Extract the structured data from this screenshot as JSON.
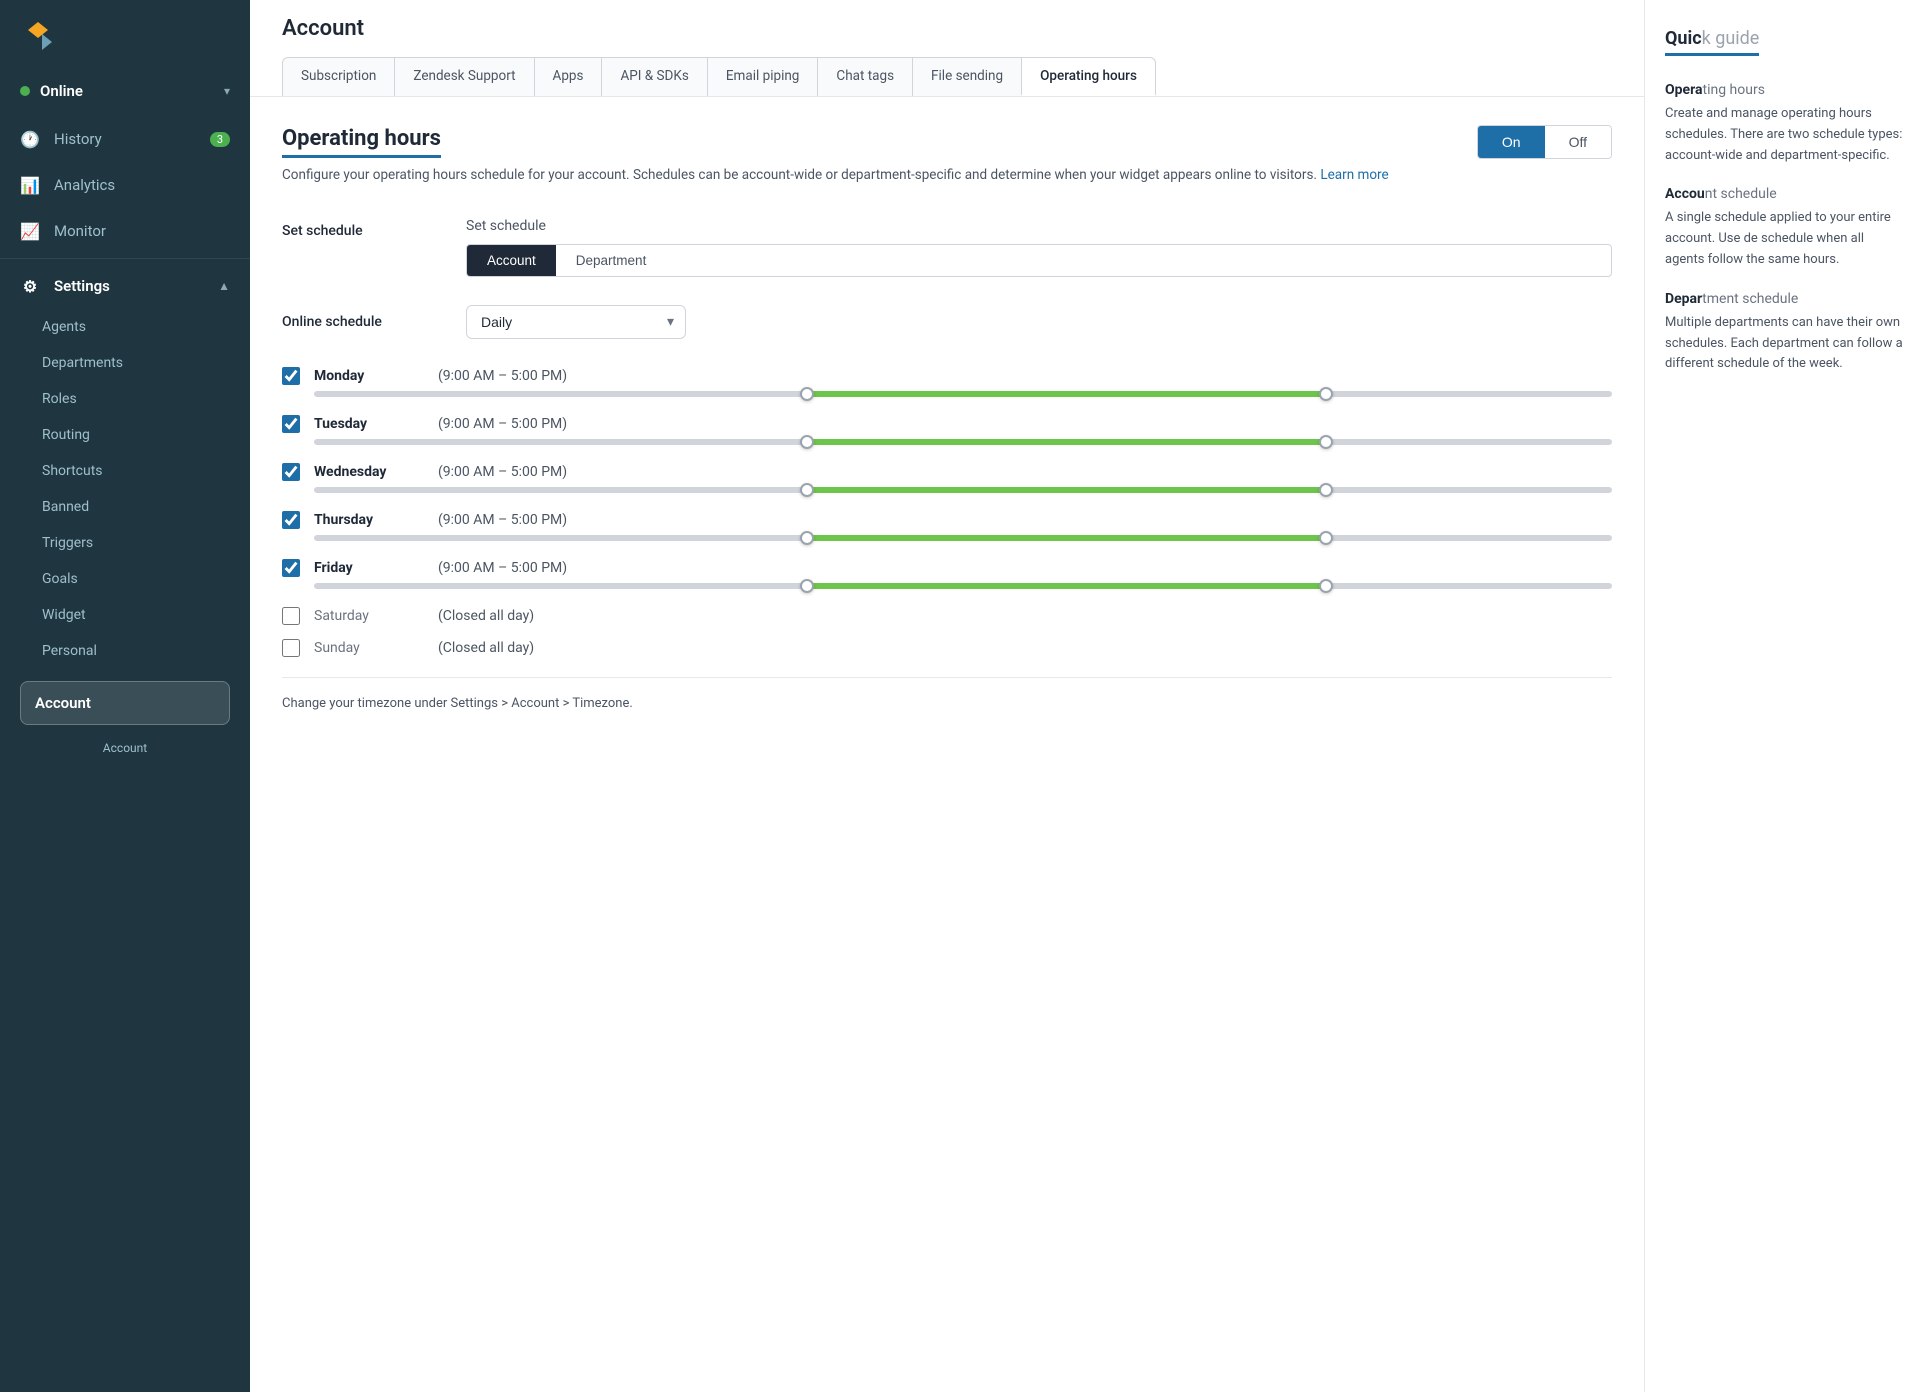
{
  "app": {
    "title": "Account"
  },
  "sidebar": {
    "logo_alt": "Zendesk Chat logo",
    "status": {
      "label": "Online",
      "color": "#4caf50"
    },
    "nav_items": [
      {
        "id": "history",
        "label": "History",
        "icon": "🕐",
        "badge": "3"
      },
      {
        "id": "analytics",
        "label": "Analytics",
        "icon": "📊",
        "badge": null
      },
      {
        "id": "monitor",
        "label": "Monitor",
        "icon": "📈",
        "badge": null
      }
    ],
    "settings": {
      "label": "Settings",
      "icon": "⚙",
      "sub_items": [
        {
          "id": "agents",
          "label": "Agents"
        },
        {
          "id": "departments",
          "label": "Departments"
        },
        {
          "id": "roles",
          "label": "Roles"
        },
        {
          "id": "routing",
          "label": "Routing"
        },
        {
          "id": "shortcuts",
          "label": "Shortcuts"
        },
        {
          "id": "banned",
          "label": "Banned"
        },
        {
          "id": "triggers",
          "label": "Triggers"
        },
        {
          "id": "goals",
          "label": "Goals"
        },
        {
          "id": "widget",
          "label": "Widget"
        },
        {
          "id": "personal",
          "label": "Personal"
        }
      ]
    },
    "account_item": {
      "label": "Account"
    },
    "account_tooltip": "Account"
  },
  "tabs": [
    {
      "id": "subscription",
      "label": "Subscription",
      "active": false
    },
    {
      "id": "zendesk-support",
      "label": "Zendesk Support",
      "active": false
    },
    {
      "id": "apps",
      "label": "Apps",
      "active": false
    },
    {
      "id": "api-sdks",
      "label": "API & SDKs",
      "active": false
    },
    {
      "id": "email-piping",
      "label": "Email piping",
      "active": false
    },
    {
      "id": "chat-tags",
      "label": "Chat tags",
      "active": false
    },
    {
      "id": "file-sending",
      "label": "File sending",
      "active": false
    },
    {
      "id": "operating-hours",
      "label": "Operating hours",
      "active": true
    }
  ],
  "operating_hours": {
    "title": "Operating hours",
    "toggle_on": "On",
    "toggle_off": "Off",
    "description": "Configure your operating hours schedule for your account. Schedules can be account-wide or department-specific and determine when your widget appears online to visitors.",
    "learn_more": "Learn more",
    "set_schedule_label": "Set schedule",
    "set_schedule_value": "Set schedule",
    "schedule_type_account": "Account",
    "schedule_type_department": "Department",
    "online_schedule_label": "Online schedule",
    "online_schedule_value": "Daily",
    "days": [
      {
        "id": "monday",
        "name": "Monday",
        "checked": true,
        "hours": "(9:00 AM – 5:00 PM)",
        "closed": false,
        "fill_left": "38%",
        "fill_width": "40%"
      },
      {
        "id": "tuesday",
        "name": "Tuesday",
        "checked": true,
        "hours": "(9:00 AM – 5:00 PM)",
        "closed": false,
        "fill_left": "38%",
        "fill_width": "40%"
      },
      {
        "id": "wednesday",
        "name": "Wednesday",
        "checked": true,
        "hours": "(9:00 AM – 5:00 PM)",
        "closed": false,
        "fill_left": "38%",
        "fill_width": "40%"
      },
      {
        "id": "thursday",
        "name": "Thursday",
        "checked": true,
        "hours": "(9:00 AM – 5:00 PM)",
        "closed": false,
        "fill_left": "38%",
        "fill_width": "40%"
      },
      {
        "id": "friday",
        "name": "Friday",
        "checked": true,
        "hours": "(9:00 AM – 5:00 PM)",
        "closed": false,
        "fill_left": "38%",
        "fill_width": "40%"
      },
      {
        "id": "saturday",
        "name": "Saturday",
        "checked": false,
        "hours": "(Closed all day)",
        "closed": true,
        "fill_left": null,
        "fill_width": null
      },
      {
        "id": "sunday",
        "name": "Sunday",
        "checked": false,
        "hours": "(Closed all day)",
        "closed": true,
        "fill_left": null,
        "fill_width": null
      }
    ],
    "bottom_note": "Change your timezone under Settings > Account > Timezone."
  },
  "quick_guide": {
    "title": "Quic",
    "sections": [
      {
        "title": "Opera",
        "text": "Create and manage schedules. There are two schedule types: depar"
      },
      {
        "title": "Accou",
        "text": "A single schedule applied to your entire account. Use de schedule"
      },
      {
        "title": "Depar",
        "text": "Multiple depar depar sched depar of the"
      }
    ]
  }
}
